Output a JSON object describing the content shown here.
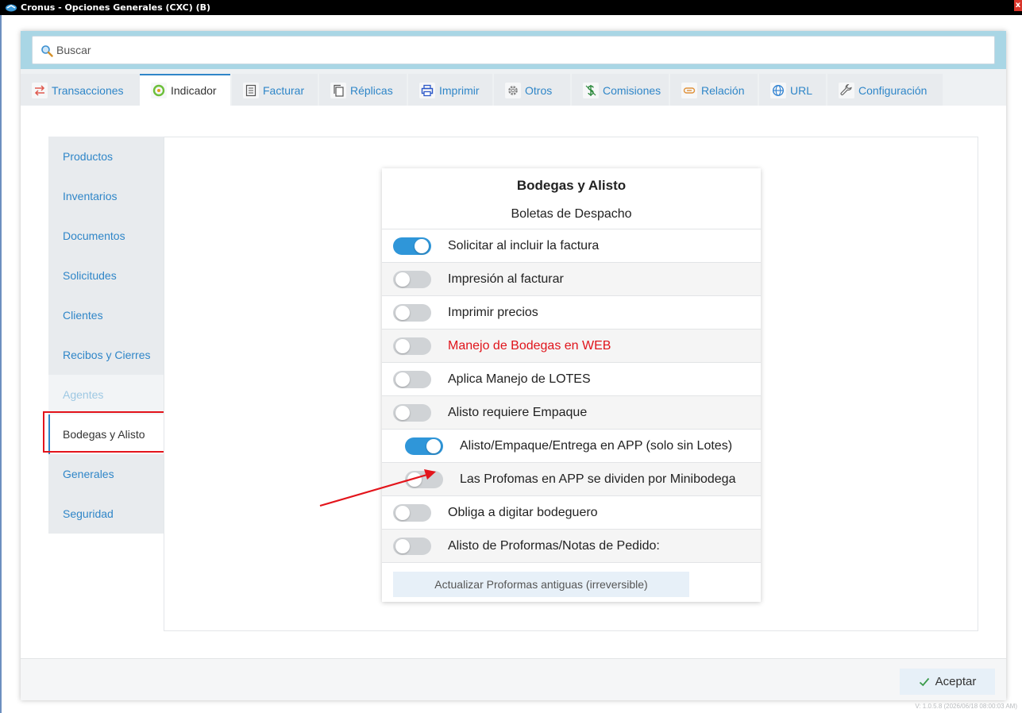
{
  "window": {
    "title": "Cronus - Opciones Generales (CXC) (B)",
    "close_label": "x"
  },
  "search": {
    "placeholder": "Buscar"
  },
  "tabs": [
    {
      "label": "Transacciones",
      "icon": "swap-arrows-icon"
    },
    {
      "label": "Indicador",
      "icon": "gauge-icon",
      "active": true
    },
    {
      "label": "Facturar",
      "icon": "invoice-icon"
    },
    {
      "label": "Réplicas",
      "icon": "copy-icon"
    },
    {
      "label": "Imprimir",
      "icon": "printer-icon"
    },
    {
      "label": "Otros",
      "icon": "gear-icon"
    },
    {
      "label": "Comisiones",
      "icon": "commission-icon"
    },
    {
      "label": "Relación",
      "icon": "link-icon"
    },
    {
      "label": "URL",
      "icon": "globe-icon"
    },
    {
      "label": "Configuración",
      "icon": "wrench-icon"
    }
  ],
  "sidebar": {
    "items": [
      {
        "label": "Productos"
      },
      {
        "label": "Inventarios"
      },
      {
        "label": "Documentos"
      },
      {
        "label": "Solicitudes"
      },
      {
        "label": "Clientes"
      },
      {
        "label": "Recibos y Cierres"
      },
      {
        "label": "Agentes",
        "disabled": true
      },
      {
        "label": "Bodegas y Alisto",
        "active": true
      },
      {
        "label": "Generales"
      },
      {
        "label": "Seguridad"
      }
    ]
  },
  "options": {
    "title": "Bodegas y Alisto",
    "subtitle": "Boletas de Despacho",
    "rows": [
      {
        "label": "Solicitar al incluir la factura",
        "on": true
      },
      {
        "label": "Impresión al facturar",
        "on": false
      },
      {
        "label": "Imprimir precios",
        "on": false
      },
      {
        "label": "Manejo de Bodegas en WEB",
        "on": false,
        "highlight_color": "#e0141b"
      },
      {
        "label": "Aplica Manejo de LOTES",
        "on": false
      },
      {
        "label": "Alisto requiere Empaque",
        "on": false
      },
      {
        "label": "Alisto/Empaque/Entrega en APP (solo sin Lotes)",
        "on": true,
        "indented": true
      },
      {
        "label": "Las Profomas en APP se dividen por Minibodega",
        "on": false,
        "indented": true
      },
      {
        "label": "Obliga a digitar bodeguero",
        "on": false
      },
      {
        "label": "Alisto de Proformas/Notas de Pedido:",
        "on": false
      }
    ],
    "update_button": "Actualizar Proformas antiguas (irreversible)"
  },
  "footer": {
    "accept_label": "Aceptar"
  },
  "version": "V: 1.0.5.8 (2026/06/18 08:00:03 AM)",
  "colors": {
    "accent": "#2f86c8",
    "toggle_on": "#2f96d9",
    "highlight_red": "#e3141b",
    "search_band": "#a9d6e5"
  }
}
